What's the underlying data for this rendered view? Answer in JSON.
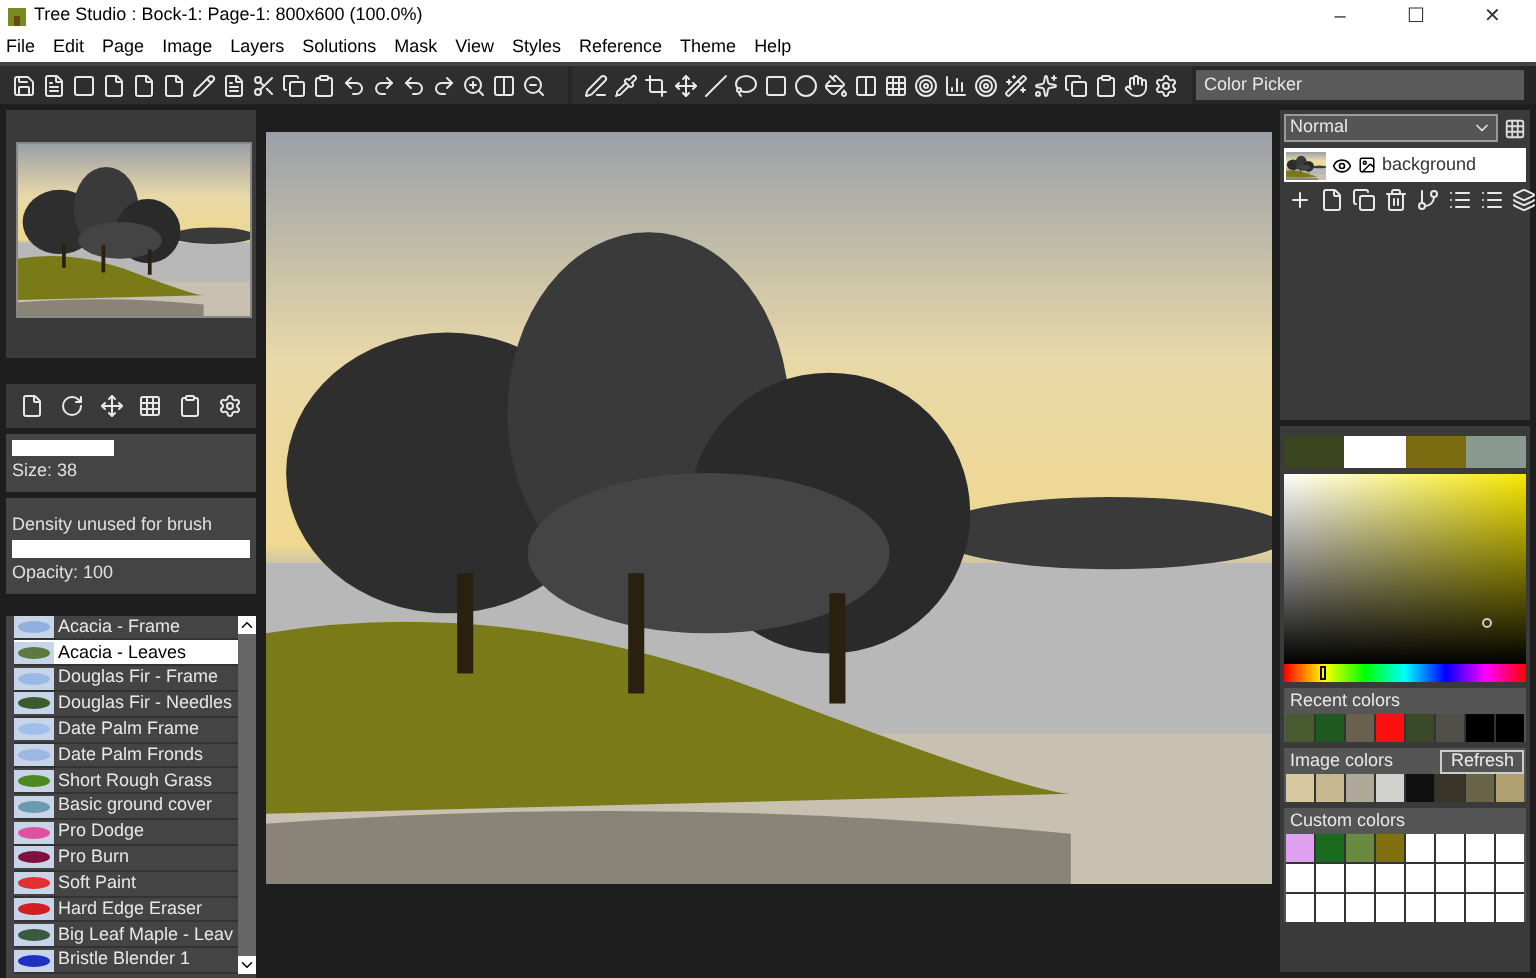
{
  "window": {
    "title": "Tree Studio : Bock-1: Page-1: 800x600  (100.0%)",
    "controls": [
      "–",
      "☐",
      "✕"
    ]
  },
  "menu": [
    "File",
    "Edit",
    "Page",
    "Image",
    "Layers",
    "Solutions",
    "Mask",
    "View",
    "Styles",
    "Reference",
    "Theme",
    "Help"
  ],
  "tool_name": "Color Picker",
  "brush_settings": {
    "size": {
      "level": 0.43,
      "label": "Size: 38"
    },
    "density_label": "Density unused for brush",
    "opacity": {
      "level": 1,
      "label": "Opacity: 100"
    }
  },
  "brushes": [
    {
      "name": "Acacia - Frame",
      "selected": false,
      "color": "#8fb0e0"
    },
    {
      "name": "Acacia - Leaves",
      "selected": true,
      "color": "#5a7a40"
    },
    {
      "name": "Douglas Fir - Frame",
      "selected": false,
      "color": "#9ab8e8"
    },
    {
      "name": "Douglas Fir - Needles",
      "selected": false,
      "color": "#3a5a30"
    },
    {
      "name": "Date Palm Frame",
      "selected": false,
      "color": "#a0c0ec"
    },
    {
      "name": "Date Palm Fronds",
      "selected": false,
      "color": "#9ab8e0"
    },
    {
      "name": "Short Rough Grass",
      "selected": false,
      "color": "#4a8a20"
    },
    {
      "name": "Basic ground cover",
      "selected": false,
      "color": "#6a9ab0"
    },
    {
      "name": "Pro Dodge",
      "selected": false,
      "color": "#e050a0"
    },
    {
      "name": "Pro Burn",
      "selected": false,
      "color": "#801040"
    },
    {
      "name": "Soft Paint",
      "selected": false,
      "color": "#e03030"
    },
    {
      "name": "Hard Edge Eraser",
      "selected": false,
      "color": "#d02020"
    },
    {
      "name": "Big Leaf Maple - Leav",
      "selected": false,
      "color": "#3a5a40"
    },
    {
      "name": "Bristle Blender 1",
      "selected": false,
      "color": "#2030c0"
    }
  ],
  "layers": {
    "blend_mode": "Normal",
    "items": [
      {
        "name": "background",
        "visible": true
      }
    ]
  },
  "swatches": [
    {
      "color": "#3b4520"
    },
    {
      "color": "#ffffff"
    },
    {
      "color": "#7a6a10"
    },
    {
      "color": "#8a9a90"
    }
  ],
  "hue": {
    "level": 0.15
  },
  "recent_colors": {
    "title": "Recent colors",
    "items": [
      {
        "color": "#4a5a30"
      },
      {
        "color": "#1e5a20"
      },
      {
        "color": "#6a6050"
      },
      {
        "color": "#ff1010"
      },
      {
        "color": "#3a4a28"
      },
      {
        "color": "#505048"
      },
      {
        "color": "#000000"
      },
      {
        "color": "#000000"
      }
    ]
  },
  "image_colors": {
    "title": "Image colors",
    "button": "Refresh",
    "items": [
      {
        "color": "#d8c8a0"
      },
      {
        "color": "#c8b890"
      },
      {
        "color": "#b0a898"
      },
      {
        "color": "#d0d0cc"
      },
      {
        "color": "#101010"
      },
      {
        "color": "#383428"
      },
      {
        "color": "#6a6448"
      },
      {
        "color": "#b0a070"
      }
    ]
  },
  "custom_colors": {
    "title": "Custom colors",
    "items": [
      {
        "color": "#e0a0f0"
      },
      {
        "color": "#1a6a20"
      },
      {
        "color": "#6a8a40"
      },
      {
        "color": "#807010"
      },
      {
        "color": "#ffffff"
      },
      {
        "color": "#ffffff"
      },
      {
        "color": "#ffffff"
      },
      {
        "color": "#ffffff"
      },
      {
        "color": "#ffffff"
      },
      {
        "color": "#ffffff"
      },
      {
        "color": "#ffffff"
      },
      {
        "color": "#ffffff"
      },
      {
        "color": "#ffffff"
      },
      {
        "color": "#ffffff"
      },
      {
        "color": "#ffffff"
      },
      {
        "color": "#ffffff"
      },
      {
        "color": "#ffffff"
      },
      {
        "color": "#ffffff"
      },
      {
        "color": "#ffffff"
      },
      {
        "color": "#ffffff"
      },
      {
        "color": "#ffffff"
      },
      {
        "color": "#ffffff"
      },
      {
        "color": "#ffffff"
      },
      {
        "color": "#ffffff"
      }
    ]
  }
}
